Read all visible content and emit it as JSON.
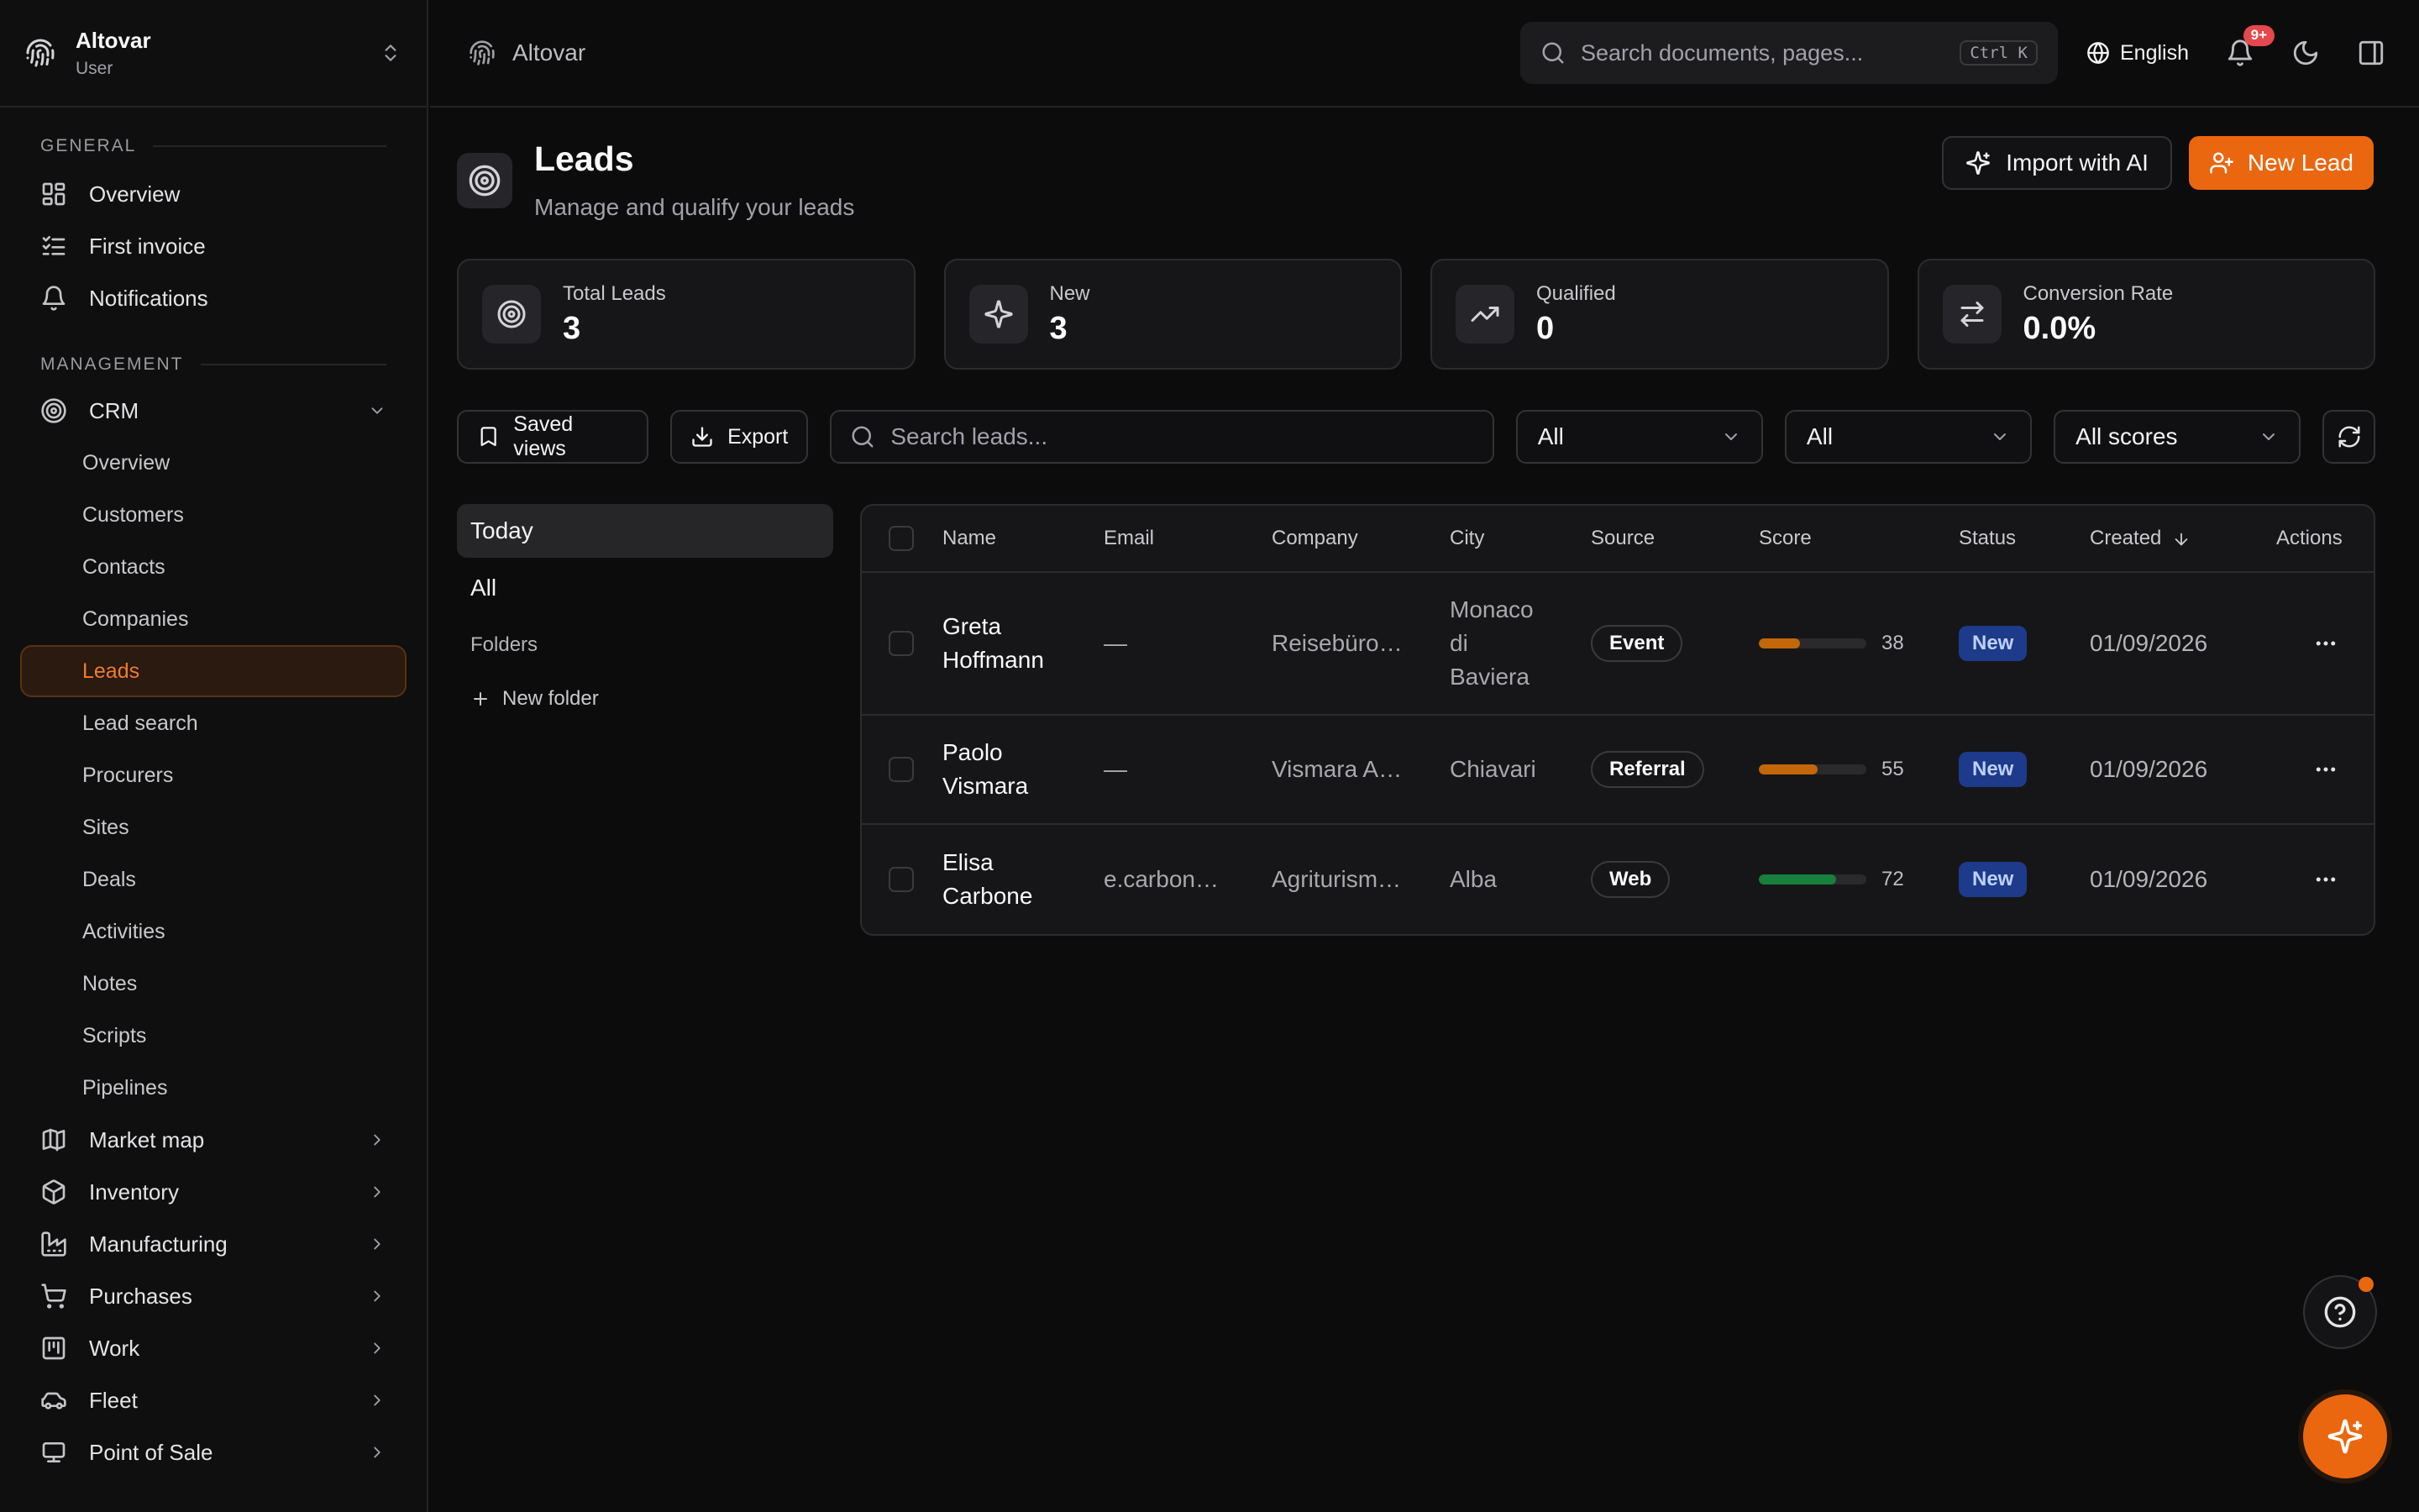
{
  "brand": {
    "app": "Altovar",
    "role": "User"
  },
  "topbar": {
    "crumb": "Altovar",
    "search_placeholder": "Search documents, pages...",
    "shortcut": "Ctrl K",
    "language": "English",
    "notif_count": "9+"
  },
  "sidebar": {
    "general_label": "GENERAL",
    "general": [
      {
        "label": "Overview",
        "icon": "dashboard-icon"
      },
      {
        "label": "First invoice",
        "icon": "list-check-icon"
      },
      {
        "label": "Notifications",
        "icon": "bell-icon"
      }
    ],
    "management_label": "MANAGEMENT",
    "crm_label": "CRM",
    "crm_items": [
      "Overview",
      "Customers",
      "Contacts",
      "Companies",
      "Leads",
      "Lead search",
      "Procurers",
      "Sites",
      "Deals",
      "Activities",
      "Notes",
      "Scripts",
      "Pipelines"
    ],
    "crm_active": "Leads",
    "modules": [
      {
        "label": "Market map",
        "icon": "map-icon"
      },
      {
        "label": "Inventory",
        "icon": "box-icon"
      },
      {
        "label": "Manufacturing",
        "icon": "factory-icon"
      },
      {
        "label": "Purchases",
        "icon": "cart-icon"
      },
      {
        "label": "Work",
        "icon": "kanban-icon"
      },
      {
        "label": "Fleet",
        "icon": "car-icon"
      },
      {
        "label": "Point of Sale",
        "icon": "pos-icon"
      }
    ]
  },
  "page": {
    "title": "Leads",
    "subtitle": "Manage and qualify your leads",
    "import_label": "Import with AI",
    "new_label": "New Lead"
  },
  "stats": [
    {
      "label": "Total Leads",
      "value": "3",
      "icon": "target-icon"
    },
    {
      "label": "New",
      "value": "3",
      "icon": "sparkles-icon"
    },
    {
      "label": "Qualified",
      "value": "0",
      "icon": "trending-up-icon"
    },
    {
      "label": "Conversion Rate",
      "value": "0.0%",
      "icon": "arrows-exchange-icon"
    }
  ],
  "filters": {
    "saved_views": "Saved views",
    "export": "Export",
    "search_placeholder": "Search leads...",
    "select1": "All",
    "select2": "All",
    "select3": "All scores"
  },
  "views": {
    "today": "Today",
    "all": "All",
    "folders": "Folders",
    "new_folder": "New folder"
  },
  "table": {
    "headers": {
      "name": "Name",
      "email": "Email",
      "company": "Company",
      "city": "City",
      "source": "Source",
      "score": "Score",
      "status": "Status",
      "created": "Created",
      "actions": "Actions"
    },
    "rows": [
      {
        "first": "Greta",
        "last": "Hoffmann",
        "email": "—",
        "company": "Reisebüro…",
        "city_lines": [
          "Monaco",
          "di",
          "Baviera"
        ],
        "source": "Event",
        "score": 38,
        "score_label": "38",
        "score_color": "#c2670a",
        "status": "New",
        "created": "01/09/2026"
      },
      {
        "first": "Paolo",
        "last": "Vismara",
        "email": "—",
        "company": "Vismara A…",
        "city_lines": [
          "Chiavari"
        ],
        "source": "Referral",
        "score": 55,
        "score_label": "55",
        "score_color": "#c2670a",
        "status": "New",
        "created": "01/09/2026"
      },
      {
        "first": "Elisa",
        "last": "Carbone",
        "email": "e.carbon…",
        "company": "Agriturism…",
        "city_lines": [
          "Alba"
        ],
        "source": "Web",
        "score": 72,
        "score_label": "72",
        "score_color": "#16803c",
        "status": "New",
        "created": "01/09/2026"
      }
    ]
  }
}
